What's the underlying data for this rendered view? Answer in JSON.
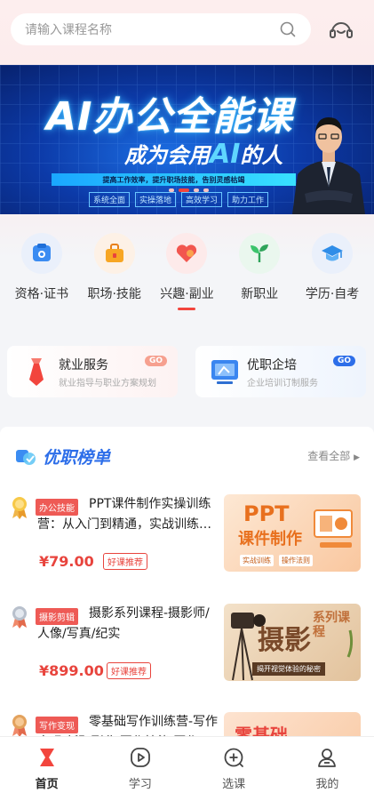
{
  "search": {
    "placeholder": "请输入课程名称"
  },
  "banner": {
    "title": "AI办公全能课",
    "subtitle_pre": "成为会用",
    "subtitle_ai": "AI",
    "subtitle_post": "的人",
    "strip": "提高工作效率，提升职场技能，告别灵感枯竭",
    "tags": [
      "系统全面",
      "实操落地",
      "高效学习",
      "助力工作"
    ]
  },
  "categories": [
    {
      "label": "资格·证书",
      "icon": "certificate-icon"
    },
    {
      "label": "职场·技能",
      "icon": "briefcase-icon"
    },
    {
      "label": "兴趣·副业",
      "icon": "heart-icon",
      "active": true
    },
    {
      "label": "新职业",
      "icon": "sprout-icon"
    },
    {
      "label": "学历·自考",
      "icon": "graduation-cap-icon"
    }
  ],
  "services": [
    {
      "title": "就业服务",
      "subtitle": "就业指导与职业方案规划",
      "go": "GO",
      "color": "#f2453d"
    },
    {
      "title": "优职企培",
      "subtitle": "企业培训订制服务",
      "go": "GO",
      "color": "#2d6ee9"
    }
  ],
  "ranking": {
    "title": "优职榜单",
    "more": "查看全部",
    "courses": [
      {
        "tag": "办公技能",
        "title": "PPT课件制作实操训练营：从入门到精通，实战训练…",
        "price": "¥79.00",
        "badge": "好课推荐",
        "thumb_title": "PPT",
        "thumb_sub": "课件制作",
        "thumb_tags": [
          "实战训练",
          "操作法则"
        ]
      },
      {
        "tag": "摄影剪辑",
        "title": "摄影系列课程-摄影师/人像/写真/纪实",
        "price": "¥899.00",
        "badge": "好课推荐",
        "thumb_title": "摄影",
        "thumb_sub": "系列课程",
        "thumb_caption": "揭开视觉体验的秘密"
      },
      {
        "tag": "写作变现",
        "title": "零基础写作训练营-写作变现·新职副业·写作技能·写作",
        "thumb_title": "零基础"
      }
    ]
  },
  "tabbar": [
    {
      "label": "首页",
      "icon": "home-icon",
      "active": true
    },
    {
      "label": "学习",
      "icon": "play-circle-icon"
    },
    {
      "label": "选课",
      "icon": "plus-circle-icon"
    },
    {
      "label": "我的",
      "icon": "user-icon"
    }
  ],
  "colors": {
    "accent": "#f2453d",
    "brand_blue": "#2d6ee9"
  }
}
